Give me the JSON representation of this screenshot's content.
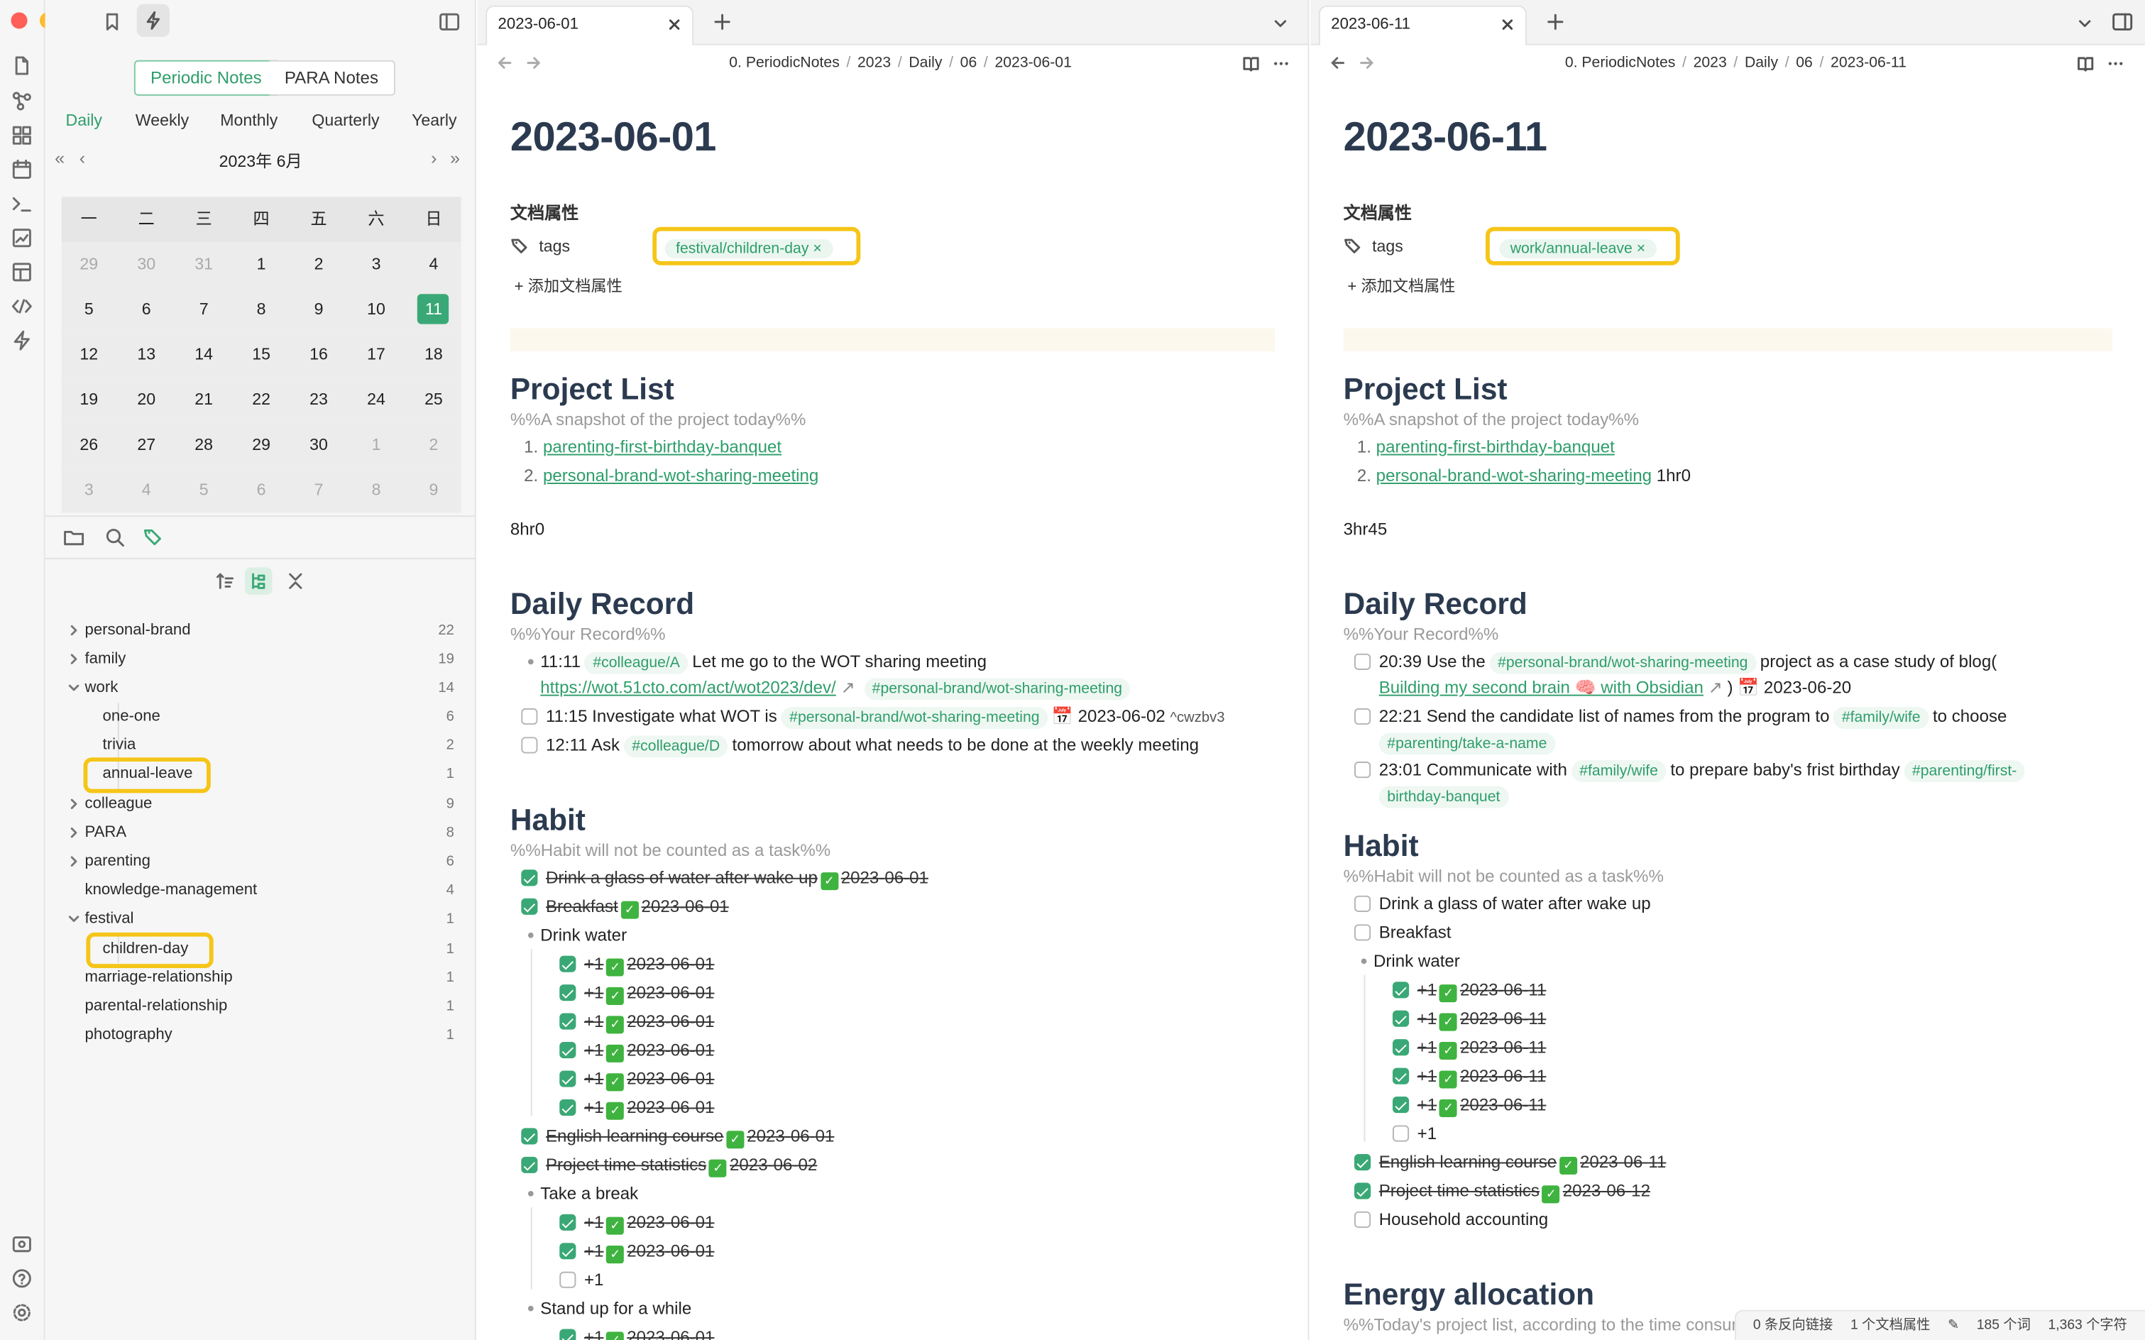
{
  "sidebar": {
    "views": [
      "Periodic Notes",
      "PARA Notes"
    ],
    "periods": [
      "Daily",
      "Weekly",
      "Monthly",
      "Quarterly",
      "Yearly"
    ],
    "calendar": {
      "title": "2023年  6月",
      "weekdays": [
        "一",
        "二",
        "三",
        "四",
        "五",
        "六",
        "日"
      ],
      "weeks": [
        [
          "29",
          "30",
          "31",
          "1",
          "2",
          "3",
          "4"
        ],
        [
          "5",
          "6",
          "7",
          "8",
          "9",
          "10",
          "11"
        ],
        [
          "12",
          "13",
          "14",
          "15",
          "16",
          "17",
          "18"
        ],
        [
          "19",
          "20",
          "21",
          "22",
          "23",
          "24",
          "25"
        ],
        [
          "26",
          "27",
          "28",
          "29",
          "30",
          "1",
          "2"
        ],
        [
          "3",
          "4",
          "5",
          "6",
          "7",
          "8",
          "9"
        ]
      ],
      "today": "11"
    },
    "tags": [
      {
        "label": "personal-brand",
        "count": "22"
      },
      {
        "label": "family",
        "count": "19"
      },
      {
        "label": "work",
        "count": "14"
      },
      {
        "label": "one-one",
        "count": "6"
      },
      {
        "label": "trivia",
        "count": "2"
      },
      {
        "label": "annual-leave",
        "count": "1"
      },
      {
        "label": "colleague",
        "count": "9"
      },
      {
        "label": "PARA",
        "count": "8"
      },
      {
        "label": "parenting",
        "count": "6"
      },
      {
        "label": "knowledge-management",
        "count": "4"
      },
      {
        "label": "festival",
        "count": "1"
      },
      {
        "label": "children-day",
        "count": "1"
      },
      {
        "label": "marriage-relationship",
        "count": "1"
      },
      {
        "label": "parental-relationship",
        "count": "1"
      },
      {
        "label": "photography",
        "count": "1"
      }
    ]
  },
  "common": {
    "props_title": "文档属性",
    "tags_key": "tags",
    "add_prop": "添加文档属性",
    "project_list": "Project List",
    "project_comment": "%%A snapshot of the project today%%",
    "project1": "parenting-first-birthday-banquet",
    "project2": "personal-brand-wot-sharing-meeting",
    "daily_record": "Daily Record",
    "record_comment": "%%Your Record%%",
    "habit": "Habit",
    "habit_comment": "%%Habit will not be counted as a task%%",
    "water_glass": "Drink a glass of water after wake up",
    "breakfast": "Breakfast",
    "drink_water": "Drink water",
    "plus1": "+1",
    "english": "English learning course",
    "project_time": "Project time statistics",
    "check_glyph": "✓"
  },
  "pane1": {
    "tab": "2023-06-01",
    "breadcrumb": [
      "0. PeriodicNotes",
      "2023",
      "Daily",
      "06",
      "2023-06-01"
    ],
    "title": "2023-06-01",
    "tag_value": "festival/children-day",
    "total_time": "8hr0",
    "rec1_time": "11:11",
    "rec1_tag": "#colleague/A",
    "rec1_text": "Let me go to the WOT sharing meeting",
    "rec1_url": "https://wot.51cto.com/act/wot2023/dev/",
    "rec1_tag2": "#personal-brand/wot-sharing-meeting",
    "rec2_text": "11:15 Investigate what WOT is",
    "rec2_tag": "#personal-brand/wot-sharing-meeting",
    "rec2_due": "📅 2023-06-02",
    "rec2_id": "^cwzbv3",
    "rec3_text": "12:11 Ask",
    "rec3_tag": "#colleague/D",
    "rec3_text2": "tomorrow about what needs to be done at the weekly meeting",
    "done_date": "2023-06-01",
    "project_time_date": "2023-06-02",
    "take_break": "Take a break",
    "stand_up": "Stand up for a while"
  },
  "pane2": {
    "tab": "2023-06-11",
    "breadcrumb": [
      "0. PeriodicNotes",
      "2023",
      "Daily",
      "06",
      "2023-06-11"
    ],
    "title": "2023-06-11",
    "tag_value": "work/annual-leave",
    "project2_time": "1hr0",
    "total_time": "3hr45",
    "rec1_text": "20:39 Use the",
    "rec1_tag": "#personal-brand/wot-sharing-meeting",
    "rec1_text2": "project as a case study of  blog(",
    "rec1_link": "Building my second brain 🧠 with Obsidian",
    "rec1_text3": ")",
    "rec1_due": "📅 2023-06-20",
    "rec2_text": "22:21 Send the candidate list of names from the program to",
    "rec2_tag": "#family/wife",
    "rec2_text2": "to choose",
    "rec2_tag2": "#parenting/take-a-name",
    "rec3_text": "23:01 Communicate with",
    "rec3_tag": "#family/wife",
    "rec3_text2": "to prepare baby's frist birthday",
    "rec3_tag2a": "#parenting/first-",
    "rec3_tag2b": "birthday-banquet",
    "done_date": "2023-06-11",
    "project_time_date": "2023-06-12",
    "household": "Household accounting",
    "energy": "Energy allocation",
    "energy_comment": "%%Today's project list, according to the time consumed"
  },
  "status": {
    "backlinks": "0 条反向链接",
    "props": "1 个文档属性",
    "words": "185 个词",
    "chars": "1,363 个字符"
  },
  "colors": {
    "accent": "#2e9e6a",
    "highlight": "#f5c518",
    "heading": "#2b3a4f"
  }
}
